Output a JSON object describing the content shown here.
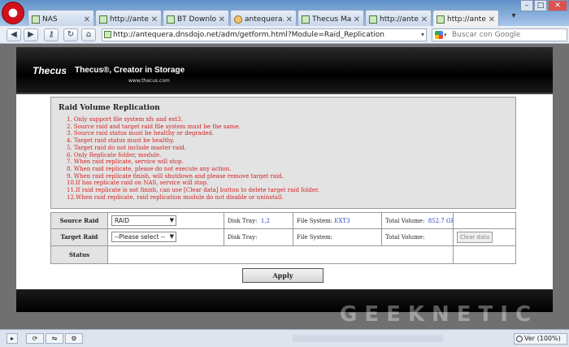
{
  "browser": {
    "tabs": [
      {
        "label": "NAS",
        "icon": "page-icon"
      },
      {
        "label": "http://anteq...",
        "icon": "page-icon"
      },
      {
        "label": "BT Download",
        "icon": "page-icon"
      },
      {
        "label": "antequera.d...",
        "icon": "torrent-icon"
      },
      {
        "label": "Thecus Mail ...",
        "icon": "page-icon"
      },
      {
        "label": "http://anteq...",
        "icon": "page-icon"
      },
      {
        "label": "http://anteq...",
        "icon": "page-icon",
        "active": true
      }
    ],
    "address": "http://antequera.dnsdojo.net/adm/getform.html?Module=Raid_Replication",
    "search_placeholder": "Buscar con Google",
    "zoom": "Ver (100%)"
  },
  "header": {
    "logo": "Thecus",
    "tagline": "Thecus®, Creator in Storage",
    "url": "www.thecus.com"
  },
  "panel": {
    "title": "Raid Volume Replication",
    "rules": [
      "1. Only support file system xfs and ext3.",
      "2. Source raid and target raid file system must be the same.",
      "3. Source raid status must be healthy or degraded.",
      "4. Target raid status must be healthy.",
      "5. Target raid do not include master raid.",
      "6. Only Replicate folder, module.",
      "7. When raid replicate, service will stop.",
      "8. When raid replicate, please do not execute any action.",
      "9. When raid replicate finish, will shutdown and please remove target raid.",
      "10.If has replicate raid on NAS, service will stop.",
      "11.If raid replicate is not finish, can use [Clear data] button to delete target raid folder.",
      "12.When raid replicate, raid replication module do not disable or uninstall."
    ]
  },
  "table": {
    "source": {
      "label": "Source Raid",
      "select": "RAID",
      "disk_tray_label": "Disk Tray:",
      "disk_tray_value": "1,2",
      "fs_label": "File System:",
      "fs_value": "EXT3",
      "total_label": "Total Volume:",
      "total_value": "852.7 GB"
    },
    "target": {
      "label": "Target Raid",
      "select": "--Please select --",
      "disk_tray_label": "Disk Tray:",
      "fs_label": "File System:",
      "total_label": "Total Volume:",
      "clear_label": "Clear data"
    },
    "status": {
      "label": "Status"
    }
  },
  "apply_label": "Apply",
  "watermark": "GEEKNETIC",
  "colors": {
    "rules_text": "#d42020",
    "value_text": "#2a3fc8",
    "panel_bg": "#e3e3e3"
  }
}
